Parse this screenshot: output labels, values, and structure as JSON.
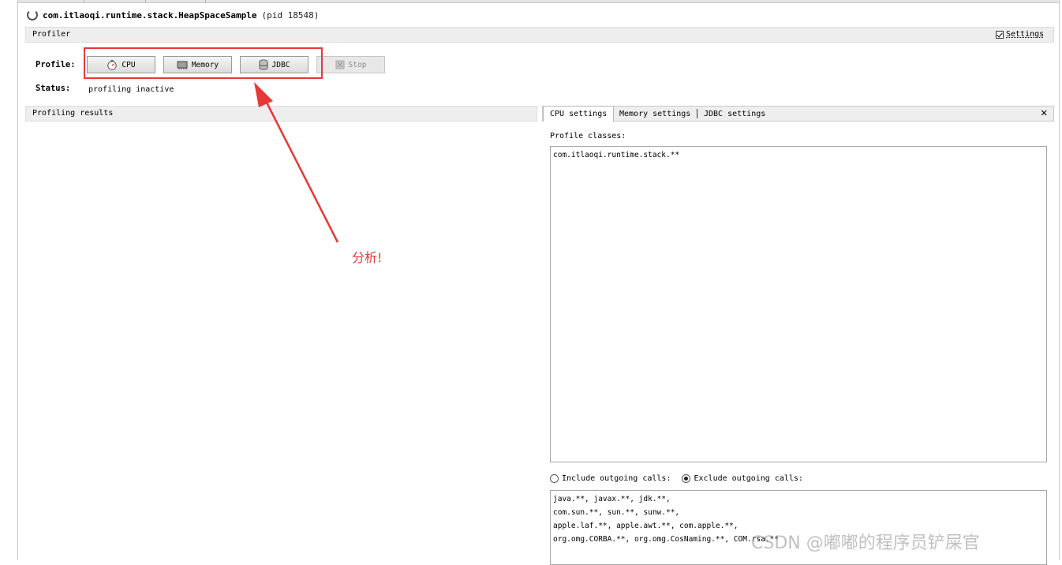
{
  "window": {
    "title": "com.itlaoqi.runtime.stack.HeapSpaceSample",
    "pid": "(pid 18548)"
  },
  "profiler": {
    "section_label": "Profiler",
    "settings_label": "Settings",
    "settings_checked": true,
    "profile_label": "Profile:",
    "buttons": {
      "cpu": "CPU",
      "memory": "Memory",
      "jdbc": "JDBC",
      "stop": "Stop"
    },
    "status_label": "Status:",
    "status_value": "profiling inactive"
  },
  "results": {
    "label": "Profiling results"
  },
  "settings_panel": {
    "tabs": [
      "CPU settings",
      "Memory settings",
      "JDBC settings"
    ],
    "active_tab": "CPU settings",
    "profile_classes_label": "Profile classes:",
    "profile_classes_value": "com.itlaoqi.runtime.stack.**",
    "include_label": "Include outgoing calls:",
    "exclude_label": "Exclude outgoing calls:",
    "selected_option": "exclude",
    "outgoing_lines": [
      "java.**,  javax.**,  jdk.**,",
      "com.sun.**,  sun.**,  sunw.**,",
      "apple.laf.**,  apple.awt.**,  com.apple.**,",
      "org.omg.CORBA.**,  org.omg.CosNaming.**,  COM.rsa.**"
    ]
  },
  "annotation": {
    "text": "分析!",
    "color": "#e53935"
  },
  "watermark": "CSDN @嘟嘟的程序员铲屎官"
}
